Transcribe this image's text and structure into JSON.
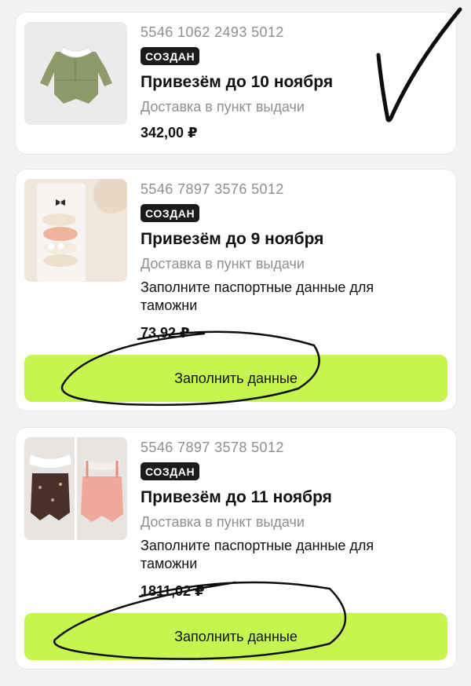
{
  "orders": [
    {
      "number": "5546 1062 2493 5012",
      "status": "СОЗДАН",
      "title": "Привезём до 10 ноября",
      "delivery": "Доставка в пункт выдачи",
      "price": "342,00 ₽"
    },
    {
      "number": "5546 7897 3576 5012",
      "status": "СОЗДАН",
      "title": "Привезём до 9 ноября",
      "delivery": "Доставка в пункт выдачи",
      "note": "Заполните паспортные данные для таможни",
      "price": "73,92 ₽",
      "button": "Заполнить данные"
    },
    {
      "number": "5546 7897 3578 5012",
      "status": "СОЗДАН",
      "title": "Привезём до 11 ноября",
      "delivery": "Доставка в пункт выдачи",
      "note": "Заполните паспортные данные для таможни",
      "price": "1811,02 ₽",
      "button": "Заполнить данные"
    }
  ],
  "colors": {
    "accent_button": "#c6f54f",
    "badge_bg": "#1b1b1b",
    "muted_text": "#8d8f94",
    "background": "#f1f2f4"
  }
}
